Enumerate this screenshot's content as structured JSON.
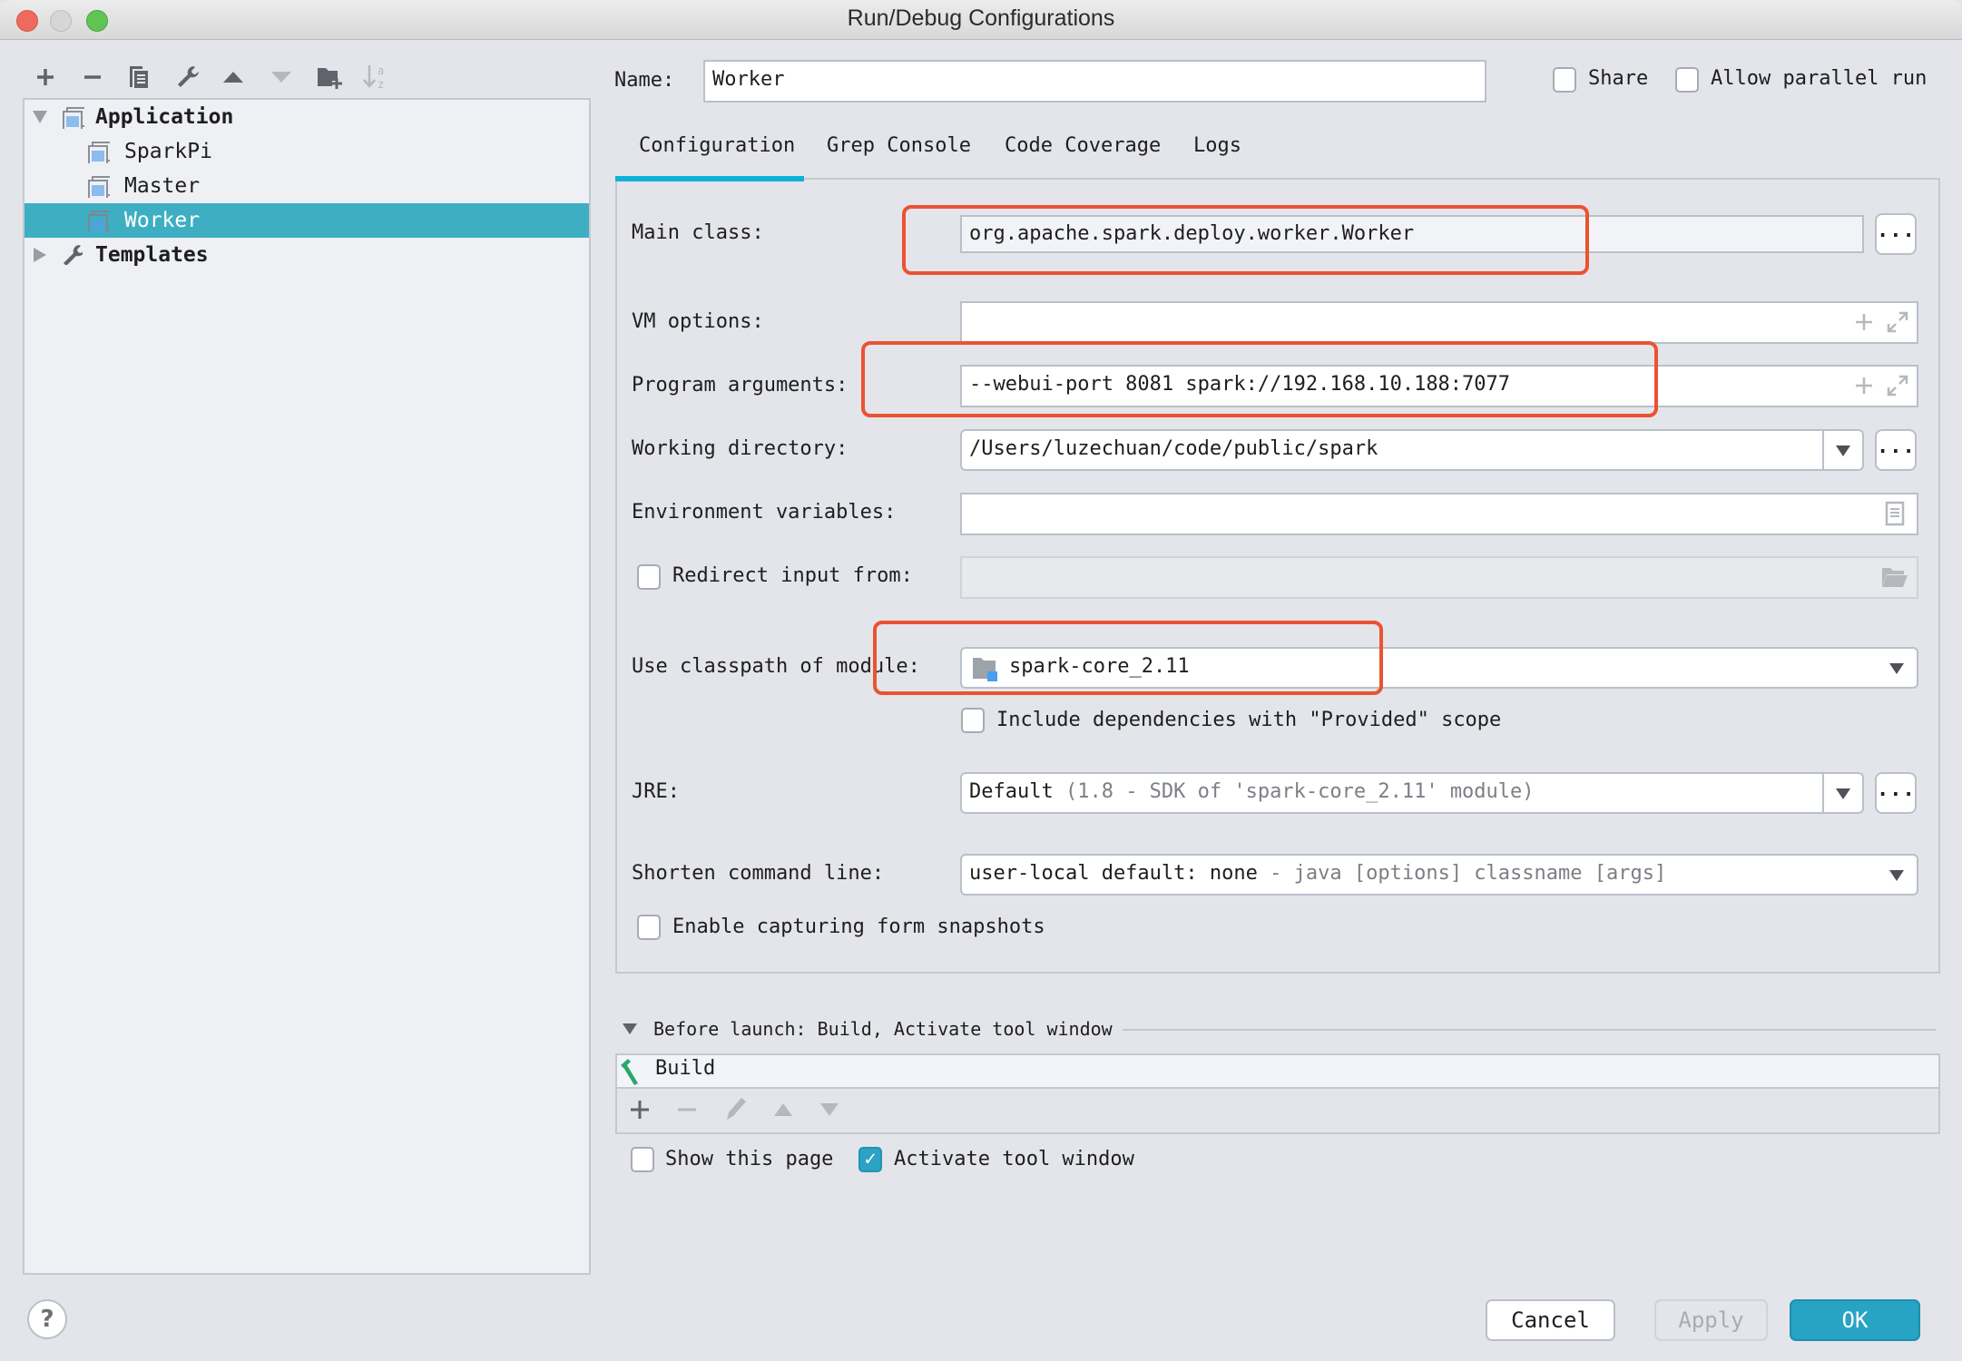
{
  "window": {
    "title": "Run/Debug Configurations"
  },
  "toolbar": {
    "icons": [
      "add-icon",
      "remove-icon",
      "copy-icon",
      "wrench-icon",
      "move-up-icon",
      "move-down-icon",
      "new-folder-icon",
      "sort-icon"
    ]
  },
  "tree": {
    "application": "Application",
    "items": [
      {
        "label": "SparkPi",
        "selected": false
      },
      {
        "label": "Master",
        "selected": false
      },
      {
        "label": "Worker",
        "selected": true
      }
    ],
    "templates": "Templates"
  },
  "header": {
    "name_label": "Name:",
    "name_value": "Worker",
    "share_label": "Share",
    "share_checked": false,
    "parallel_label": "Allow parallel run",
    "parallel_checked": false
  },
  "tabs": [
    {
      "label": "Configuration",
      "active": true
    },
    {
      "label": "Grep Console",
      "active": false
    },
    {
      "label": "Code Coverage",
      "active": false
    },
    {
      "label": "Logs",
      "active": false
    }
  ],
  "form": {
    "main_class_label": "Main class:",
    "main_class_value": "org.apache.spark.deploy.worker.Worker",
    "vm_options_label": "VM options:",
    "vm_options_value": "",
    "program_args_label": "Program arguments:",
    "program_args_value": "--webui-port 8081 spark://192.168.10.188:7077",
    "working_dir_label": "Working directory:",
    "working_dir_value": "/Users/luzechuan/code/public/spark",
    "env_vars_label": "Environment variables:",
    "env_vars_value": "",
    "redirect_label": "Redirect input from:",
    "redirect_checked": false,
    "classpath_label": "Use classpath of module:",
    "classpath_value": "spark-core_2.11",
    "include_deps_label": "Include dependencies with \"Provided\" scope",
    "include_deps_checked": false,
    "jre_label": "JRE:",
    "jre_value": "Default",
    "jre_hint": "(1.8 - SDK of 'spark-core_2.11' module)",
    "shorten_label": "Shorten command line:",
    "shorten_value": "user-local default: none",
    "shorten_hint": "- java [options] classname [args]",
    "snapshots_label": "Enable capturing form snapshots",
    "snapshots_checked": false,
    "dots": "..."
  },
  "before_launch": {
    "title": "Before launch: Build, Activate tool window",
    "tasks": [
      "Build"
    ],
    "show_page_label": "Show this page",
    "show_page_checked": false,
    "activate_label": "Activate tool window",
    "activate_checked": true
  },
  "footer": {
    "help": "?",
    "cancel": "Cancel",
    "apply": "Apply",
    "ok": "OK"
  },
  "colors": {
    "accent": "#2ba3c5",
    "selection": "#3eafc2",
    "highlight_box": "#ea5330",
    "build_icon": "#2aa66b"
  }
}
